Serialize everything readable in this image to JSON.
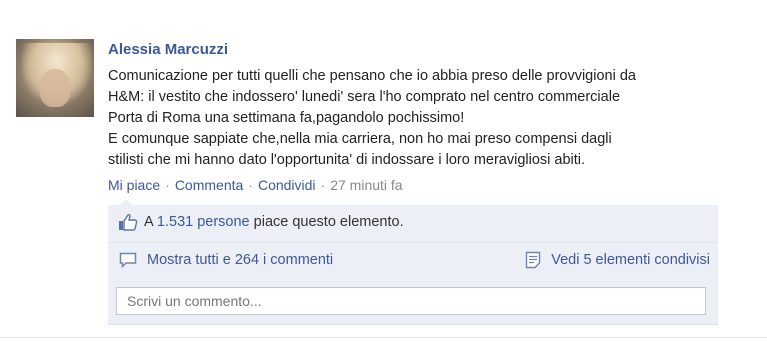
{
  "post": {
    "author": "Alessia Marcuzzi",
    "message_lines": [
      "Comunicazione per tutti quelli che pensano che io abbia preso delle provvigioni da",
      "H&M: il vestito che indossero' lunedi' sera l'ho comprato nel centro commerciale",
      "Porta di Roma una settimana fa,pagandolo pochissimo!",
      "E comunque sappiate che,nella mia carriera, non ho mai preso compensi dagli",
      "stilisti che mi hanno dato l'opportunita' di indossare i loro meravigliosi abiti."
    ]
  },
  "actions": {
    "like": "Mi piace",
    "comment": "Commenta",
    "share": "Condividi",
    "separator": "·",
    "time": "27 minuti fa"
  },
  "likes": {
    "prefix": "A",
    "count": "1.531 persone",
    "suffix": "piace questo elemento."
  },
  "comments": {
    "show_all": "Mostra tutti e 264 i commenti",
    "shares": "Vedi 5 elementi condivisi",
    "input_placeholder": "Scrivi un commento..."
  },
  "icons": {
    "like": "thumbs-up-icon",
    "comment": "speech-bubble-icon",
    "share": "share-document-icon"
  },
  "colors": {
    "link": "#3b5998",
    "panel": "#eceff5"
  }
}
